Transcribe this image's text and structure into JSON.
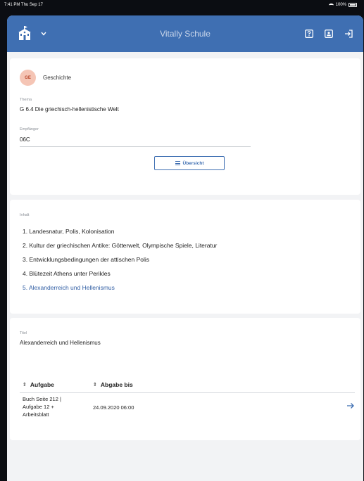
{
  "status_bar": {
    "time": "7:41 PM  Thu Sep 17",
    "battery": "100%"
  },
  "navbar": {
    "title": "Vitally Schule",
    "icons": [
      "school-icon",
      "chevron-down-icon",
      "help-icon",
      "contacts-icon",
      "logout-icon"
    ]
  },
  "subject": {
    "badge": "GE",
    "name": "Geschichte"
  },
  "theme": {
    "label": "Thema",
    "value": "G 6.4 Die griechisch-hellenistische Welt"
  },
  "recipient": {
    "label": "Empfänger",
    "value": "06C"
  },
  "overview_button": {
    "label": "Übersicht"
  },
  "content": {
    "label": "Inhalt",
    "items": [
      {
        "text": "1. Landesnatur, Polis, Kolonisation"
      },
      {
        "text": "2. Kultur der griechischen Antike: Götterwelt, Olympische Spiele, Literatur"
      },
      {
        "text": "3. Entwicklungsbedingungen der attischen Polis"
      },
      {
        "text": "4. Blütezeit Athens unter Perikles"
      },
      {
        "text": "5. Alexanderreich und Hellenismus"
      }
    ],
    "active_index": 4
  },
  "detail": {
    "title_label": "Titel",
    "title_value": "Alexanderreich und Hellenismus",
    "columns": {
      "task": "Aufgabe",
      "due": "Abgabe bis"
    },
    "rows": [
      {
        "task": "Buch Seite 212 | Aufgabe 12 + Arbeitsblatt",
        "due": "24.09.2020 06:00"
      }
    ]
  },
  "colors": {
    "accent": "#3f6fb2",
    "badge_bg": "#f5c5b5",
    "active_link": "#2f5da3"
  }
}
